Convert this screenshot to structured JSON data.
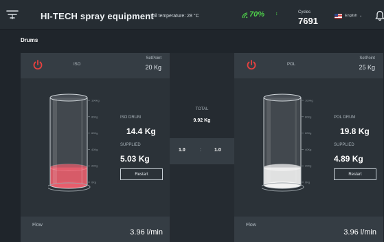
{
  "header": {
    "title": "HI-TECH spray equipment",
    "oil_temperature": "Oil temperature: 28 °C",
    "signal_percent": "70%",
    "signal_trend": "↕",
    "cycles_label": "Cycles",
    "cycles_value": "7691",
    "language": "English",
    "menu_icon": "menu-icon",
    "bell_icon": "bell-icon"
  },
  "section": {
    "title": "Drums"
  },
  "drums": [
    {
      "name": "ISO",
      "setpoint_label": "SetPoint",
      "setpoint_value": "20 Kg",
      "drum_label": "ISO DRUM",
      "drum_weight": "14.4 Kg",
      "supplied_label": "SUPPLIED",
      "supplied_value": "5.03 Kg",
      "restart_label": "Restart",
      "flow_label": "Flow",
      "flow_value": "3.96  l/min",
      "fill_fraction": 0.2,
      "liquid_color": "#e85d6c",
      "scale": [
        "100Kg",
        "80Kg",
        "60Kg",
        "40Kg",
        "20Kg",
        "0Kg"
      ]
    },
    {
      "name": "POL",
      "setpoint_label": "SetPoint",
      "setpoint_value": "25 Kg",
      "drum_label": "POL DRUM",
      "drum_weight": "19.8 Kg",
      "supplied_label": "SUPPLIED",
      "supplied_value": "4.89 Kg",
      "restart_label": "Restart",
      "flow_label": "Flow",
      "flow_value": "3.96  l/min",
      "fill_fraction": 0.2,
      "liquid_color": "#f2f2f2",
      "scale": [
        "100Kg",
        "80Kg",
        "60Kg",
        "40Kg",
        "20Kg",
        "0Kg"
      ]
    }
  ],
  "center": {
    "total_label": "TOTAL",
    "total_value": "9.92 Kg",
    "ratio_left": "1.0",
    "ratio_sep": ":",
    "ratio_right": "1.0"
  },
  "colors": {
    "accent_green": "#4ed24a",
    "power_red": "#e8413f",
    "background": "#1f252b",
    "panel": "#2b3238",
    "panel_header": "#353d44"
  }
}
